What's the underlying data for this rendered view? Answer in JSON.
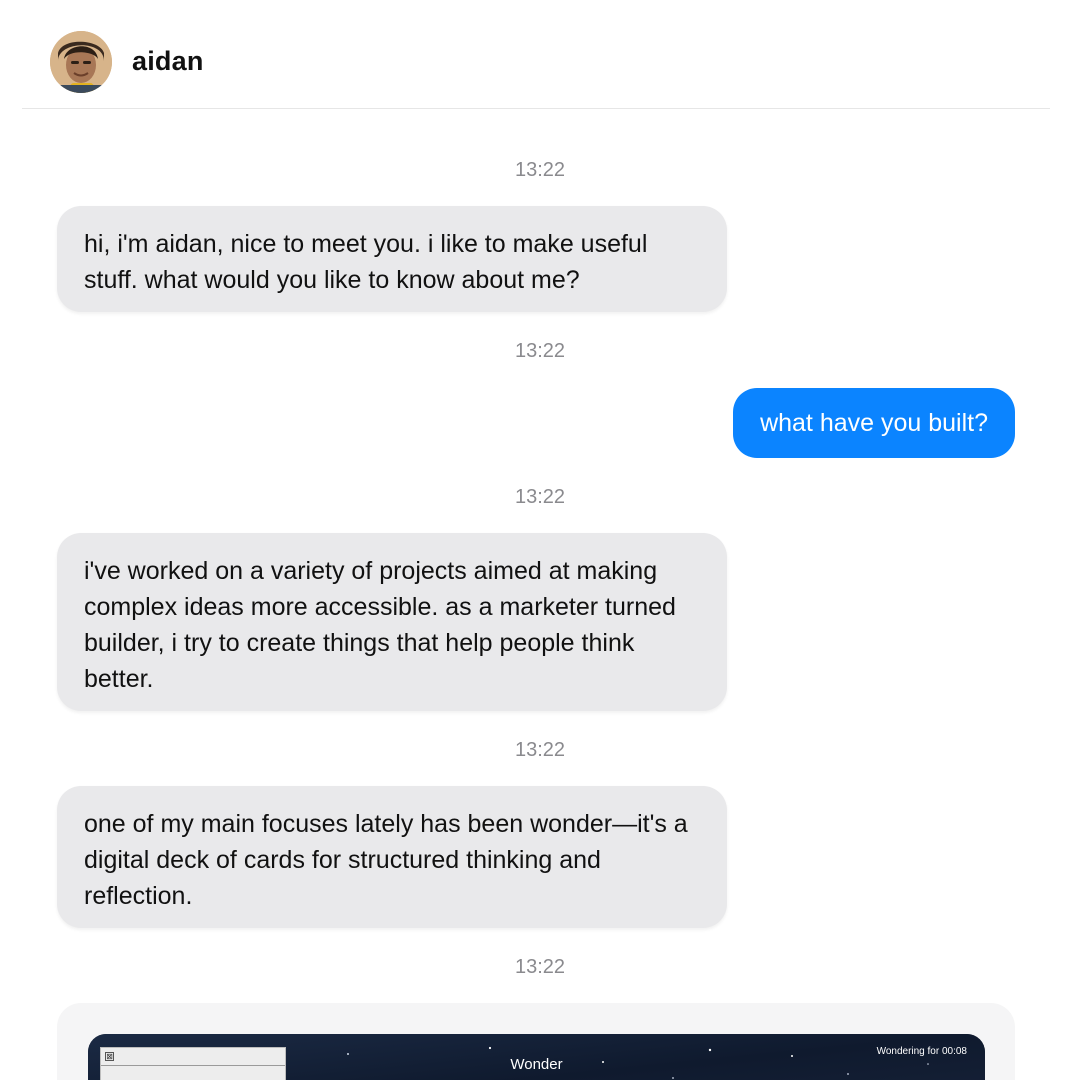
{
  "header": {
    "contact_name": "aidan",
    "avatar_icon": "user-avatar-icon"
  },
  "messages": [
    {
      "timestamp": "13:22",
      "sender": "aidan",
      "text": "hi, i'm aidan, nice to meet you. i like to make useful stuff. what would you like to know about me?"
    },
    {
      "timestamp": "13:22",
      "sender": "me",
      "text": "what have you built?"
    },
    {
      "timestamp": "13:22",
      "sender": "aidan",
      "text": "i've worked on a variety of projects aimed at making complex ideas more accessible. as a marketer turned builder, i try to create things that help people think better."
    },
    {
      "timestamp": "13:22",
      "sender": "aidan",
      "text": "one of my main focuses lately has been wonder—it's a digital deck of cards for structured thinking and reflection."
    },
    {
      "timestamp": "13:22",
      "sender": "aidan",
      "text": ""
    }
  ],
  "preview": {
    "title": "Wonder",
    "timer": "Wondering for 00:08",
    "close_glyph": "⊠"
  },
  "colors": {
    "incoming_bubble": "#e9e9eb",
    "outgoing_bubble": "#0b84ff",
    "timestamp": "#8a8a8e",
    "preview_background": "#141f33"
  }
}
